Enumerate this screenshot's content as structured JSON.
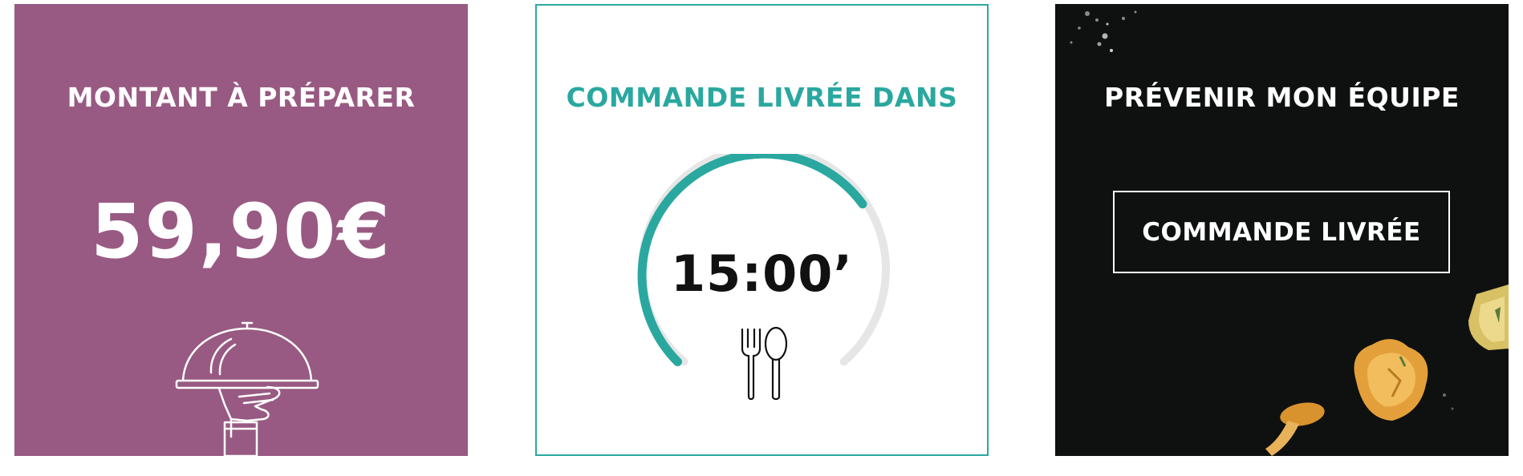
{
  "amount_card": {
    "title": "MONTANT À PRÉPARER",
    "amount": "59,90€",
    "icon": "serving-cloche-icon",
    "background": "#985a82"
  },
  "timer_card": {
    "title": "COMMANDE LIVRÉE DANS",
    "time": "15:00’",
    "icon": "cutlery-icon",
    "accent": "#2aa8a0",
    "progress": 0.7
  },
  "team_card": {
    "title": "PRÉVENIR MON ÉQUIPE",
    "button_label": "COMMANDE LIVRÉE",
    "background": "#0f1111",
    "decor": [
      "mushroom-icon",
      "potato-icon",
      "herbs-icon"
    ]
  }
}
